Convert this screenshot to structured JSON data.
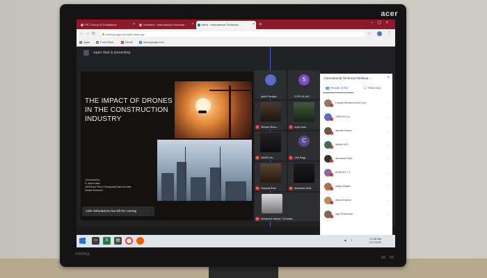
{
  "monitor": {
    "brand": "acer",
    "model": "V206HQL"
  },
  "browser": {
    "tabs": [
      {
        "label": "PET Group Of Institutions"
      },
      {
        "label": "Invitation : International Technical..."
      },
      {
        "label": "Meet - International Technical..."
      }
    ],
    "url": "meet.google.com/sdk-xabb-zgs",
    "bookmarks": [
      {
        "label": "Apps"
      },
      {
        "label": "Food Rack"
      },
      {
        "label": "Gmail"
      },
      {
        "label": "www.google.com"
      }
    ]
  },
  "meet": {
    "presenting_text": "super deal is presenting",
    "slide": {
      "title": "THE IMPACT OF DRONES IN THE CONSTRUCTION INDUSTRY",
      "presented_by": [
        "-Presented by",
        "S. Ankit Krishn",
        "uAV/Drone Pilot & Geospatial Data Scientist,",
        "Market Research"
      ]
    },
    "toast": "Ankit Vishwakarma has left the meeting",
    "tiles": [
      {
        "name": "parth Parugan",
        "initial": "",
        "color": "#5d6cc9"
      },
      {
        "name": "SYED ALJAZ...",
        "initial": "S",
        "color": "#7b4bbf"
      },
      {
        "name": "Shivam Shiva...",
        "initial": "",
        "color": ""
      },
      {
        "name": "super deal",
        "initial": "",
        "color": ""
      },
      {
        "name": "NAVED ALI",
        "initial": "",
        "color": ""
      },
      {
        "name": "Civil Engg",
        "initial": "C",
        "color": "#5a4a8a"
      },
      {
        "name": "Dawood Bhai",
        "initial": "",
        "color": ""
      },
      {
        "name": "Abubakar Bello",
        "initial": "",
        "color": ""
      },
      {
        "name": "Mohamed Usman T M Aasia...",
        "initial": "",
        "color": ""
      }
    ]
  },
  "panel": {
    "title": "International Technical Webinar ...",
    "people_tab": "People (179)",
    "chat_tab": "Chat (34)",
    "participants": [
      "s gopal Ramamoorthy (You)",
      "19BS043 111",
      "aashish Bhave",
      "Abishe M R",
      "Abubakar Bello",
      "ADARSH T S",
      "aditya Waghe",
      "Aisha Kharani",
      "ajay Phutkumar"
    ]
  },
  "taskbar": {
    "time": "11:35 AM",
    "date": "7/17/2020"
  }
}
